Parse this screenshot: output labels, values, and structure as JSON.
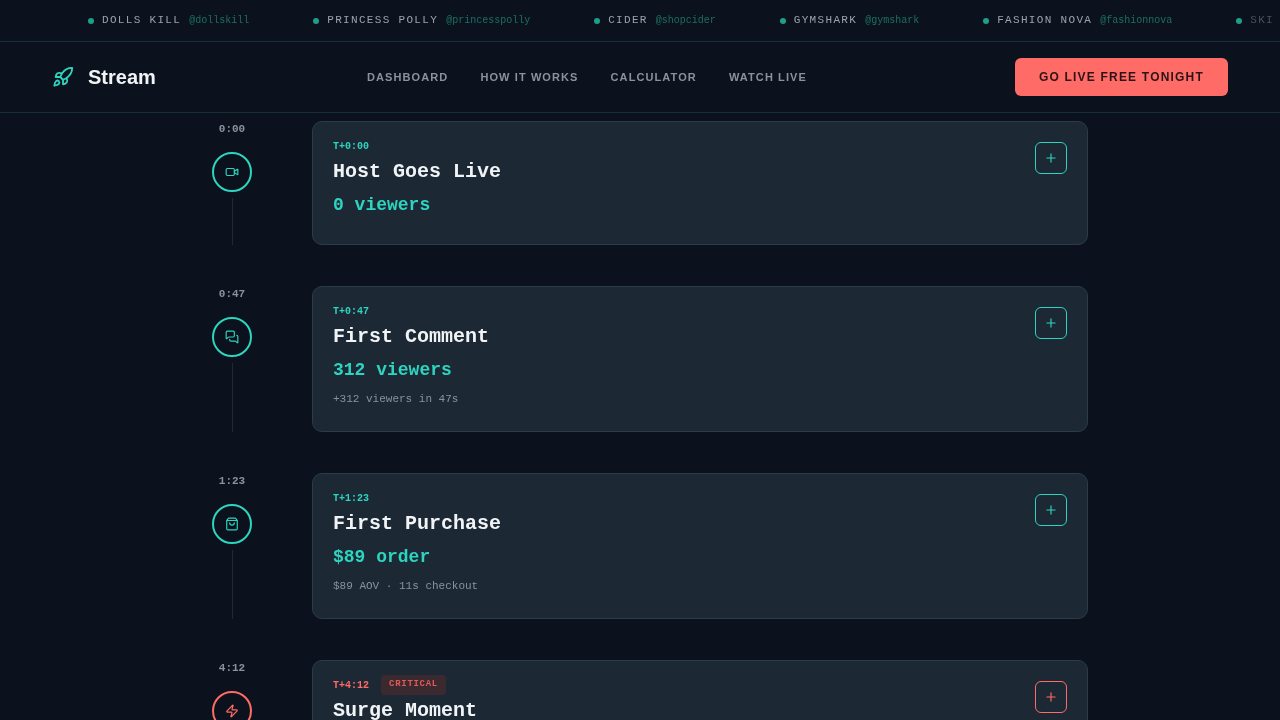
{
  "ticker": [
    {
      "brand": "DOLLS KILL",
      "handle": "@dollskill"
    },
    {
      "brand": "PRINCESS POLLY",
      "handle": "@princesspolly"
    },
    {
      "brand": "CIDER",
      "handle": "@shopcider"
    },
    {
      "brand": "GYMSHARK",
      "handle": "@gymshark"
    },
    {
      "brand": "FASHION NOVA",
      "handle": "@fashionnova"
    },
    {
      "brand": "SKI"
    }
  ],
  "header": {
    "logo": "Stream",
    "nav": [
      "DASHBOARD",
      "HOW IT WORKS",
      "CALCULATOR",
      "WATCH LIVE"
    ],
    "cta": "GO LIVE FREE TONIGHT"
  },
  "timeline": [
    {
      "kind": "live",
      "time": "0:00",
      "tag": "T+0:00",
      "critical": false,
      "title": "Host Goes Live",
      "metric": "0 viewers"
    },
    {
      "kind": "comment",
      "time": "0:47",
      "tag": "T+0:47",
      "critical": false,
      "title": "First Comment",
      "metric": "312 viewers",
      "note": "+312 viewers in 47s"
    },
    {
      "kind": "purchase",
      "time": "1:23",
      "tag": "T+1:23",
      "critical": false,
      "title": "First Purchase",
      "metric": "$89 order",
      "note": "$89 AOV · 11s checkout"
    },
    {
      "kind": "surge",
      "time": "4:12",
      "tag": "T+4:12",
      "critical": true,
      "badge": "CRITICAL",
      "title": "Surge Moment"
    }
  ]
}
